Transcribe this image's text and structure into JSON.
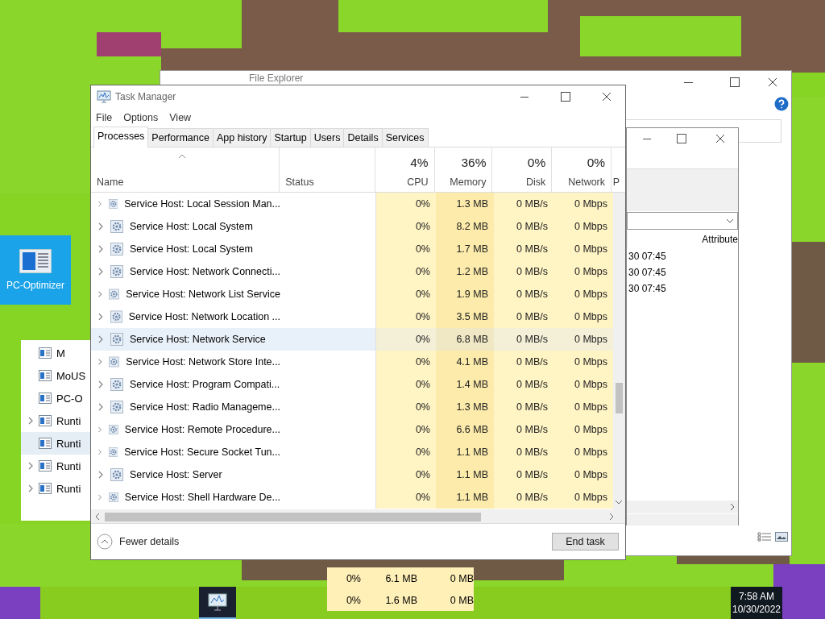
{
  "desktop": {
    "icon": {
      "label": "PC-Optimizer"
    }
  },
  "file_explorer": {
    "title": "File Explorer",
    "dialog": {
      "column": "Attribute",
      "rows": [
        "30 07:45",
        "30 07:45",
        "30 07:45"
      ]
    }
  },
  "side_list": {
    "items": [
      {
        "label": "M",
        "expandable": false,
        "selected": false
      },
      {
        "label": "MoUS",
        "expandable": false,
        "selected": false
      },
      {
        "label": "PC-O",
        "expandable": false,
        "selected": false
      },
      {
        "label": "Runti",
        "expandable": true,
        "selected": false
      },
      {
        "label": "Runti",
        "expandable": false,
        "selected": true
      },
      {
        "label": "Runti",
        "expandable": true,
        "selected": false
      },
      {
        "label": "Runti",
        "expandable": true,
        "selected": false
      }
    ]
  },
  "task_manager": {
    "title": "Task Manager",
    "menu": [
      "File",
      "Options",
      "View"
    ],
    "tabs": [
      {
        "label": "Processes",
        "selected": true
      },
      {
        "label": "Performance",
        "selected": false
      },
      {
        "label": "App history",
        "selected": false
      },
      {
        "label": "Startup",
        "selected": false
      },
      {
        "label": "Users",
        "selected": false
      },
      {
        "label": "Details",
        "selected": false
      },
      {
        "label": "Services",
        "selected": false
      }
    ],
    "columns": [
      {
        "label": "Name"
      },
      {
        "label": "Status"
      },
      {
        "label": "CPU",
        "usage": "4%"
      },
      {
        "label": "Memory",
        "usage": "36%"
      },
      {
        "label": "Disk",
        "usage": "0%"
      },
      {
        "label": "Network",
        "usage": "0%"
      },
      {
        "label": "P"
      }
    ],
    "rows": [
      {
        "name": "Service Host: Local Session Man...",
        "cpu": "0%",
        "memory": "1.3 MB",
        "disk": "0 MB/s",
        "network": "0 Mbps",
        "selected": false
      },
      {
        "name": "Service Host: Local System",
        "cpu": "0%",
        "memory": "8.2 MB",
        "disk": "0 MB/s",
        "network": "0 Mbps",
        "selected": false
      },
      {
        "name": "Service Host: Local System",
        "cpu": "0%",
        "memory": "1.7 MB",
        "disk": "0 MB/s",
        "network": "0 Mbps",
        "selected": false
      },
      {
        "name": "Service Host: Network Connecti...",
        "cpu": "0%",
        "memory": "1.2 MB",
        "disk": "0 MB/s",
        "network": "0 Mbps",
        "selected": false
      },
      {
        "name": "Service Host: Network List Service",
        "cpu": "0%",
        "memory": "1.9 MB",
        "disk": "0 MB/s",
        "network": "0 Mbps",
        "selected": false
      },
      {
        "name": "Service Host: Network Location ...",
        "cpu": "0%",
        "memory": "3.5 MB",
        "disk": "0 MB/s",
        "network": "0 Mbps",
        "selected": false
      },
      {
        "name": "Service Host: Network Service",
        "cpu": "0%",
        "memory": "6.8 MB",
        "disk": "0 MB/s",
        "network": "0 Mbps",
        "selected": true
      },
      {
        "name": "Service Host: Network Store Inte...",
        "cpu": "0%",
        "memory": "4.1 MB",
        "disk": "0 MB/s",
        "network": "0 Mbps",
        "selected": false
      },
      {
        "name": "Service Host: Program Compati...",
        "cpu": "0%",
        "memory": "1.4 MB",
        "disk": "0 MB/s",
        "network": "0 Mbps",
        "selected": false
      },
      {
        "name": "Service Host: Radio Manageme...",
        "cpu": "0%",
        "memory": "1.3 MB",
        "disk": "0 MB/s",
        "network": "0 Mbps",
        "selected": false
      },
      {
        "name": "Service Host: Remote Procedure...",
        "cpu": "0%",
        "memory": "6.6 MB",
        "disk": "0 MB/s",
        "network": "0 Mbps",
        "selected": false
      },
      {
        "name": "Service Host: Secure Socket Tun...",
        "cpu": "0%",
        "memory": "1.1 MB",
        "disk": "0 MB/s",
        "network": "0 Mbps",
        "selected": false
      },
      {
        "name": "Service Host: Server",
        "cpu": "0%",
        "memory": "1.1 MB",
        "disk": "0 MB/s",
        "network": "0 Mbps",
        "selected": false
      },
      {
        "name": "Service Host: Shell Hardware De...",
        "cpu": "0%",
        "memory": "1.1 MB",
        "disk": "0 MB/s",
        "network": "0 Mbps",
        "selected": false
      }
    ],
    "fewer_details": "Fewer details",
    "end_task": "End task"
  },
  "ghost_rows": [
    {
      "cpu": "0%",
      "memory": "6.1 MB",
      "disk": "0 MB"
    },
    {
      "cpu": "0%",
      "memory": "1.6 MB",
      "disk": "0 MB"
    }
  ],
  "taskbar": {
    "time": "7:58 AM",
    "date": "10/30/2022"
  }
}
